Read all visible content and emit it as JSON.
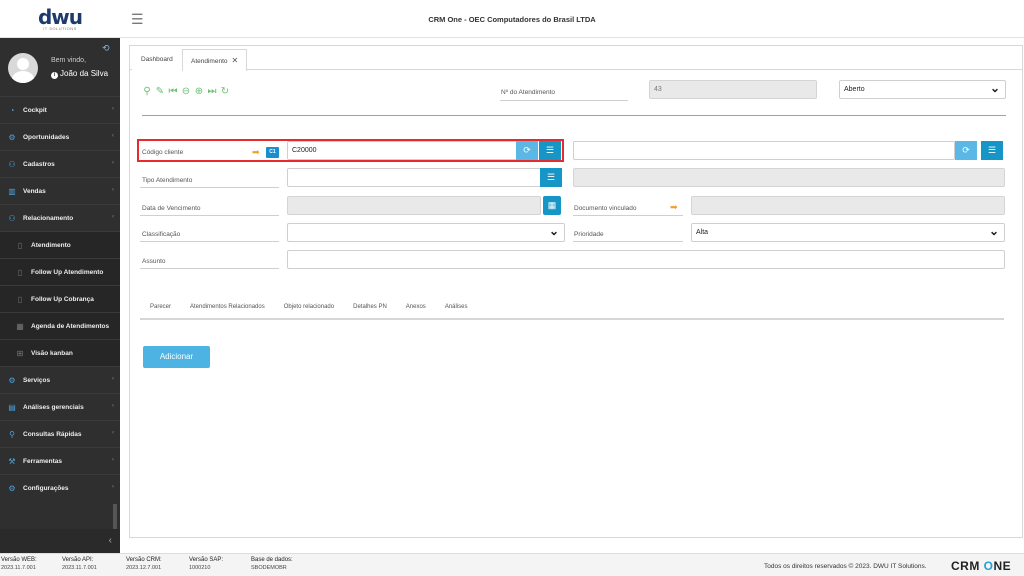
{
  "header": {
    "logo_main": "dwu",
    "logo_sub": "IT SOLUTIONS",
    "title": "CRM One - OEC Computadores do Brasil LTDA"
  },
  "user": {
    "welcome": "Bem vindo,",
    "name": "João da Silva"
  },
  "sidebar": {
    "items": [
      {
        "label": "Cockpit",
        "icon": "speedometer-icon",
        "sub": false
      },
      {
        "label": "Oportunidades",
        "icon": "gear-icon",
        "sub": false
      },
      {
        "label": "Cadastros",
        "icon": "user-icon",
        "sub": false
      },
      {
        "label": "Vendas",
        "icon": "chart-icon",
        "sub": false
      },
      {
        "label": "Relacionamento",
        "icon": "users-icon",
        "sub": false
      },
      {
        "label": "Atendimento",
        "icon": "document-icon",
        "sub": true
      },
      {
        "label": "Follow Up Atendimento",
        "icon": "document-icon",
        "sub": true
      },
      {
        "label": "Follow Up Cobrança",
        "icon": "document-icon",
        "sub": true
      },
      {
        "label": "Agenda de Atendimentos",
        "icon": "calendar-icon",
        "sub": true
      },
      {
        "label": "Visão kanban",
        "icon": "grid-icon",
        "sub": true
      },
      {
        "label": "Serviços",
        "icon": "gear-icon",
        "sub": false
      },
      {
        "label": "Análises gerenciais",
        "icon": "clipboard-icon",
        "sub": false
      },
      {
        "label": "Consultas Rápidas",
        "icon": "search-icon",
        "sub": false
      },
      {
        "label": "Ferramentas",
        "icon": "wrench-icon",
        "sub": false
      },
      {
        "label": "Configurações",
        "icon": "gear-icon",
        "sub": false
      }
    ]
  },
  "tabs": [
    {
      "label": "Dashboard"
    },
    {
      "label": "Atendimento"
    }
  ],
  "form": {
    "numero_label": "Nº do Atendimento",
    "numero_value": "43",
    "status_value": "Aberto",
    "codigo_cliente_label": "Código cliente",
    "codigo_cliente_badge": "C1",
    "codigo_cliente_value": "C20000",
    "cliente_nome_value": "",
    "tipo_atendimento_label": "Tipo Atendimento",
    "data_vencimento_label": "Data de Vencimento",
    "documento_vinculado_label": "Documento vinculado",
    "classificacao_label": "Classificação",
    "prioridade_label": "Prioridade",
    "prioridade_value": "Alta",
    "assunto_label": "Assunto"
  },
  "subtabs": [
    {
      "label": "Parecer"
    },
    {
      "label": "Atendimentos Relacionados"
    },
    {
      "label": "Objeto relacionado"
    },
    {
      "label": "Detalhes PN"
    },
    {
      "label": "Anexos"
    },
    {
      "label": "Análises"
    }
  ],
  "buttons": {
    "adicionar": "Adicionar"
  },
  "footer": {
    "versions": [
      {
        "k": "Versão WEB:",
        "v": "2023.11.7.001"
      },
      {
        "k": "Versão API:",
        "v": "2023.11.7.001"
      },
      {
        "k": "Versão CRM:",
        "v": "2023.12.7.001"
      },
      {
        "k": "Versão SAP:",
        "v": "1000210"
      },
      {
        "k": "Base de dados:",
        "v": "SBODEMOBR"
      }
    ],
    "copyright": "Todos os direitos reservados © 2023.   DWU IT Solutions.",
    "brand_a": "CRM ",
    "brand_b": "O",
    "brand_c": "NE"
  },
  "colors": {
    "accent": "#5bb8e6",
    "sidebar_bg": "#2f2f2f",
    "highlight": "#e52b2b"
  }
}
